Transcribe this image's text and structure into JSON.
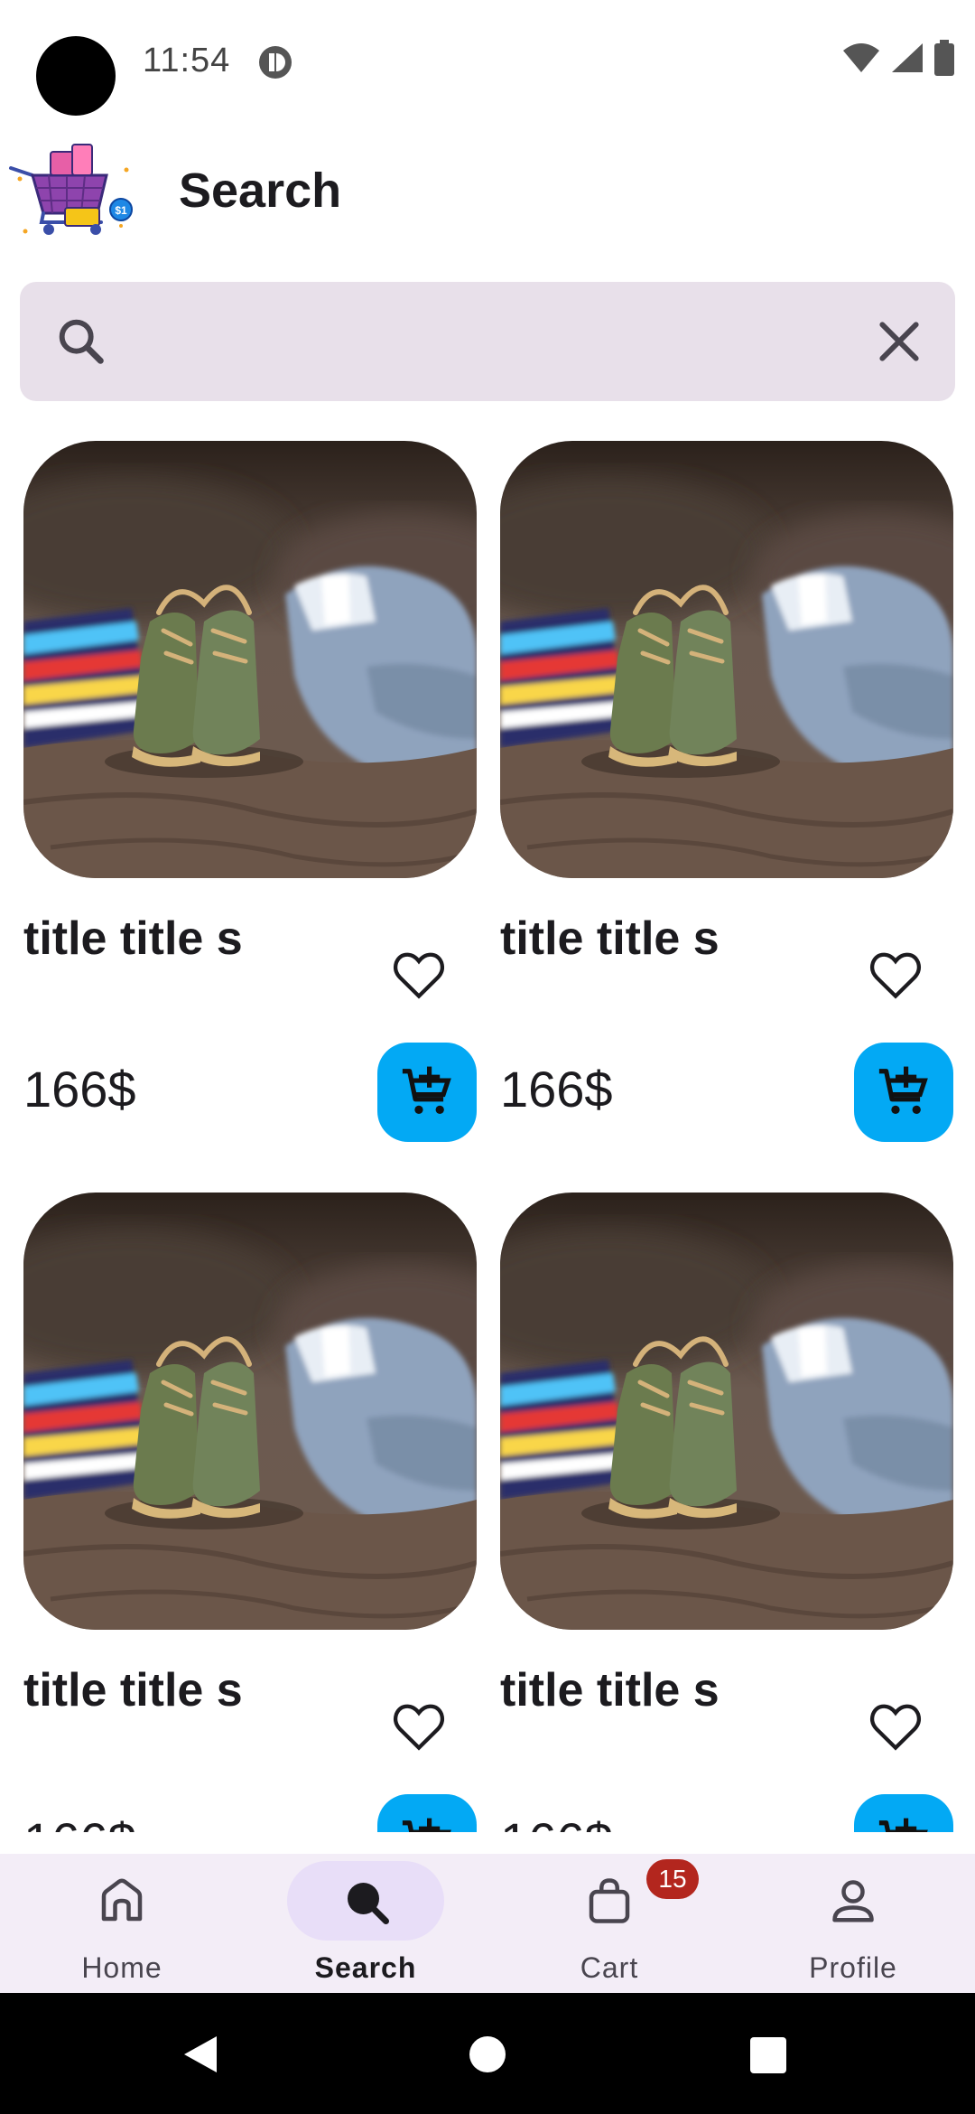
{
  "status_bar": {
    "time": "11:54"
  },
  "app_bar": {
    "title": "Search",
    "logo_icon": "shopping-cart-logo"
  },
  "search": {
    "value": "",
    "placeholder": ""
  },
  "products": [
    {
      "title": "title title s",
      "price": "166$"
    },
    {
      "title": "title title s",
      "price": "166$"
    },
    {
      "title": "title title s",
      "price": "166$"
    },
    {
      "title": "title title s",
      "price": "166$"
    }
  ],
  "bottom_nav": {
    "items": [
      {
        "label": "Home",
        "icon": "home-icon"
      },
      {
        "label": "Search",
        "icon": "search-icon",
        "active": true
      },
      {
        "label": "Cart",
        "icon": "shopping-bag-icon",
        "badge": "15"
      },
      {
        "label": "Profile",
        "icon": "person-icon"
      }
    ]
  },
  "colors": {
    "accent": "#03a9f4",
    "search_bg": "#e8e0ea",
    "nav_bg": "#f3edf7",
    "nav_active": "#e8def8",
    "badge": "#b3261e"
  }
}
